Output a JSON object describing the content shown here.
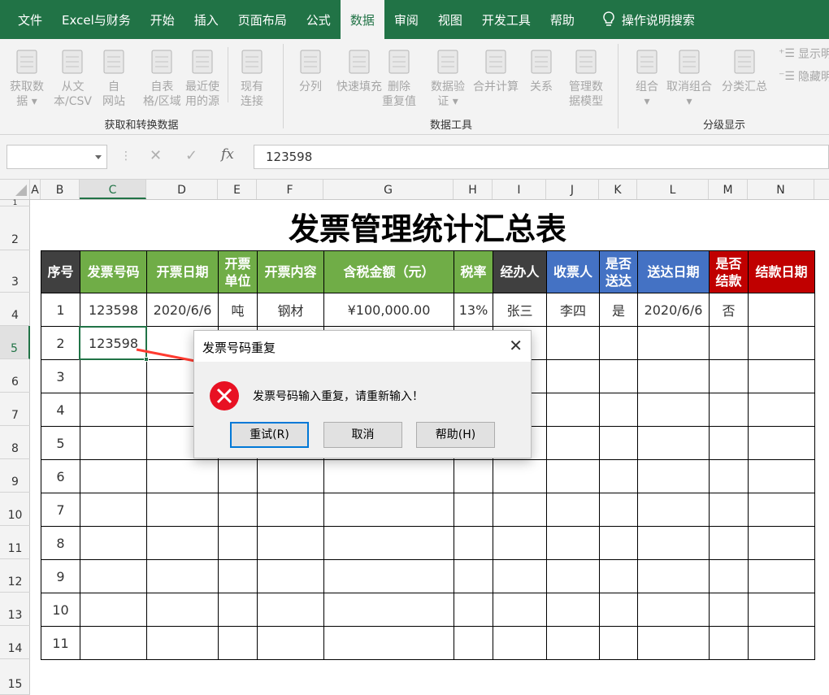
{
  "tabs": [
    "文件",
    "Excel与财务",
    "开始",
    "插入",
    "页面布局",
    "公式",
    "数据",
    "审阅",
    "视图",
    "开发工具",
    "帮助"
  ],
  "tell_me": "操作说明搜索",
  "ribbon": {
    "groups": [
      {
        "label": "获取和转换数据",
        "buttons": [
          {
            "label": "获取数\n据 ▾",
            "icon": "database-icon"
          },
          {
            "label": "从文\n本/CSV",
            "icon": "text-file-icon"
          },
          {
            "label": "自\n网站",
            "icon": "web-icon"
          },
          {
            "label": "自表\n格/区域",
            "icon": "table-icon"
          },
          {
            "label": "最近使\n用的源",
            "icon": "recent-sources-icon"
          },
          {
            "label": "现有\n连接",
            "icon": "existing-connections-icon"
          }
        ]
      },
      {
        "label": "数据工具",
        "buttons": [
          {
            "label": "分列",
            "icon": "text-to-columns-icon"
          },
          {
            "label": "快速填充",
            "icon": "flash-fill-icon"
          },
          {
            "label": "删除\n重复值",
            "icon": "remove-duplicates-icon"
          },
          {
            "label": "数据验\n证 ▾",
            "icon": "data-validation-icon"
          },
          {
            "label": "合并计算",
            "icon": "consolidate-icon"
          },
          {
            "label": "关系",
            "icon": "relationships-icon"
          },
          {
            "label": "管理数\n据模型",
            "icon": "data-model-icon"
          }
        ]
      },
      {
        "label": "分级显示",
        "buttons": [
          {
            "label": "组合\n▾",
            "icon": "group-icon"
          },
          {
            "label": "取消组合\n▾",
            "icon": "ungroup-icon"
          },
          {
            "label": "分类汇总",
            "icon": "subtotal-icon"
          }
        ],
        "small": [
          "显示明",
          "隐藏明"
        ]
      }
    ]
  },
  "formula_bar": {
    "name_box": "",
    "value": "123598"
  },
  "columns": [
    "A",
    "B",
    "C",
    "D",
    "E",
    "F",
    "G",
    "H",
    "I",
    "J",
    "K",
    "L",
    "M",
    "N"
  ],
  "selected_column": "C",
  "rows": [
    "1",
    "2",
    "3",
    "4",
    "5",
    "6",
    "7",
    "8",
    "9",
    "10",
    "11",
    "12",
    "13",
    "14",
    "15"
  ],
  "selected_row": "5",
  "sheet": {
    "title": "发票管理统计汇总表",
    "headers": [
      {
        "label": "序号",
        "color": "#404040"
      },
      {
        "label": "发票号码",
        "color": "#70ad47"
      },
      {
        "label": "开票日期",
        "color": "#70ad47"
      },
      {
        "label": "开票\n单位",
        "color": "#70ad47"
      },
      {
        "label": "开票内容",
        "color": "#70ad47"
      },
      {
        "label": "含税金额（元）",
        "color": "#70ad47"
      },
      {
        "label": "税率",
        "color": "#70ad47"
      },
      {
        "label": "经办人",
        "color": "#404040"
      },
      {
        "label": "收票人",
        "color": "#4472c4"
      },
      {
        "label": "是否\n送达",
        "color": "#4472c4"
      },
      {
        "label": "送达日期",
        "color": "#4472c4"
      },
      {
        "label": "是否\n结款",
        "color": "#c00000"
      },
      {
        "label": "结款日期",
        "color": "#c00000"
      }
    ],
    "rows": [
      [
        "1",
        "123598",
        "2020/6/6",
        "吨",
        "钢材",
        "¥100,000.00",
        "13%",
        "张三",
        "李四",
        "是",
        "2020/6/6",
        "否",
        ""
      ],
      [
        "2",
        "123598",
        "",
        "",
        "",
        "",
        "",
        "",
        "",
        "",
        "",
        "",
        ""
      ],
      [
        "3",
        "",
        "",
        "",
        "",
        "",
        "",
        "",
        "",
        "",
        "",
        "",
        ""
      ],
      [
        "4",
        "",
        "",
        "",
        "",
        "",
        "",
        "",
        "",
        "",
        "",
        "",
        ""
      ],
      [
        "5",
        "",
        "",
        "",
        "",
        "",
        "",
        "",
        "",
        "",
        "",
        "",
        ""
      ],
      [
        "6",
        "",
        "",
        "",
        "",
        "",
        "",
        "",
        "",
        "",
        "",
        "",
        ""
      ],
      [
        "7",
        "",
        "",
        "",
        "",
        "",
        "",
        "",
        "",
        "",
        "",
        "",
        ""
      ],
      [
        "8",
        "",
        "",
        "",
        "",
        "",
        "",
        "",
        "",
        "",
        "",
        "",
        ""
      ],
      [
        "9",
        "",
        "",
        "",
        "",
        "",
        "",
        "",
        "",
        "",
        "",
        "",
        ""
      ],
      [
        "10",
        "",
        "",
        "",
        "",
        "",
        "",
        "",
        "",
        "",
        "",
        "",
        ""
      ],
      [
        "11",
        "",
        "",
        "",
        "",
        "",
        "",
        "",
        "",
        "",
        "",
        "",
        ""
      ]
    ]
  },
  "dialog": {
    "title": "发票号码重复",
    "message": "发票号码输入重复，请重新输入！",
    "retry": "重试(R)",
    "cancel": "取消",
    "help": "帮助(H)"
  },
  "colors": {
    "accent": "#217346",
    "error": "#e81123",
    "arrow": "#ff3b30"
  }
}
